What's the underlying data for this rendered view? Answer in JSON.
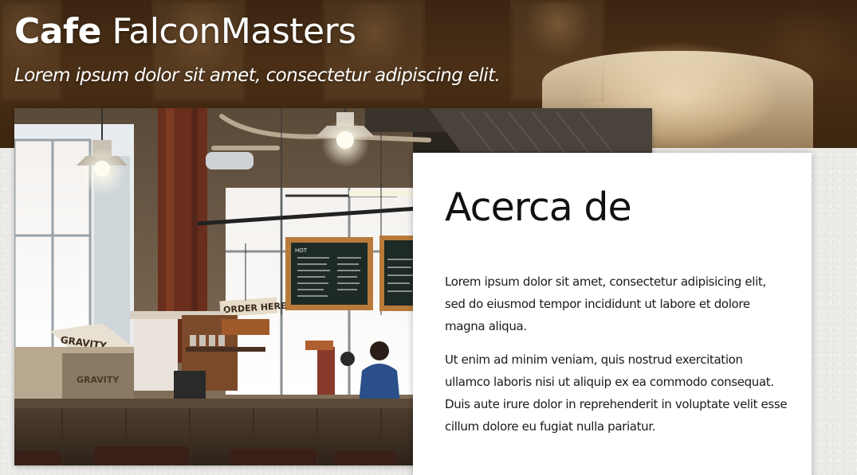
{
  "header": {
    "brand_strong": "Cafe",
    "brand_rest": "FalconMasters",
    "tagline": "Lorem ipsum dolor sit amet, consectetur adipiscing elit."
  },
  "photo": {
    "menu_board_label": "HOT",
    "order_sign": "ORDER HERE",
    "crate_label": "GRAVITY"
  },
  "about": {
    "title": "Acerca de",
    "paragraphs": [
      "Lorem ipsum dolor sit amet, consectetur adipisicing elit, sed do eiusmod tempor incididunt ut labore et dolore magna aliqua.",
      "Ut enim ad minim veniam, quis nostrud exercitation ullamco laboris nisi ut aliquip ex ea commodo consequat. Duis aute irure dolor in reprehenderit in voluptate velit esse cillum dolore eu fugiat nulla pariatur."
    ]
  },
  "colors": {
    "hero_brown": "#4a2f16",
    "card_bg": "#ffffff",
    "page_bg": "#ecebe8",
    "text": "#1a1a1a"
  }
}
